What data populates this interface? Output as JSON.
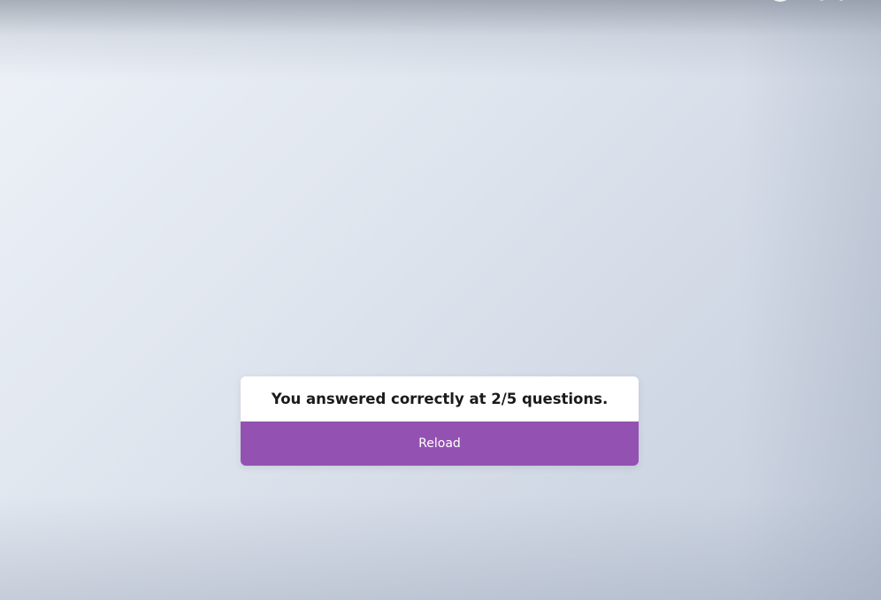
{
  "result": {
    "message": "You answered correctly at 2/5 questions.",
    "score_correct": 2,
    "score_total": 5,
    "reload_label": "Reload"
  },
  "colors": {
    "reload_button": "#9352b1",
    "card_background": "#ffffff",
    "text": "#1a1a1a"
  },
  "icons": {
    "top_right": "user-avatar-icon"
  }
}
